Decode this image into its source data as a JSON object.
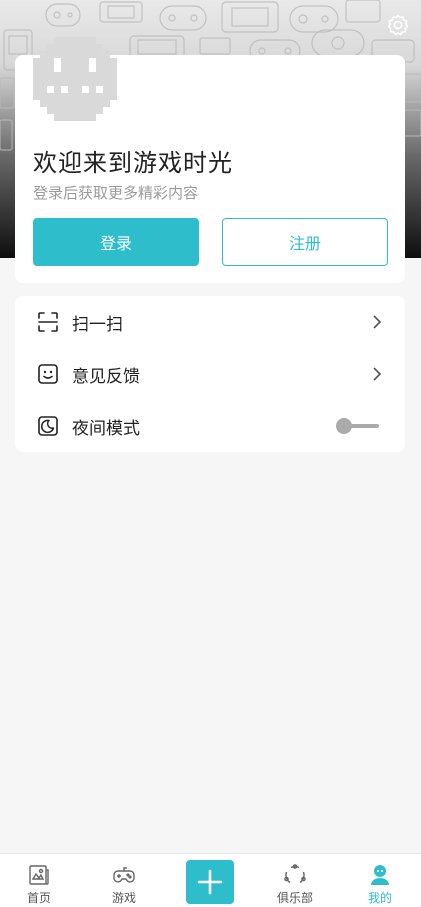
{
  "colors": {
    "accent": "#2dbdcb",
    "text": "#222222",
    "muted": "#9a9a9a",
    "background": "#f6f6f6"
  },
  "header": {
    "settings_icon": "gear-icon"
  },
  "profile": {
    "avatar_icon": "pixel-avatar-icon",
    "welcome": "欢迎来到游戏时光",
    "subtitle": "登录后获取更多精彩内容",
    "login_label": "登录",
    "register_label": "注册"
  },
  "menu": {
    "items": [
      {
        "label": "扫一扫",
        "icon": "scan-icon",
        "trailing": "chevron"
      },
      {
        "label": "意见反馈",
        "icon": "feedback-face-icon",
        "trailing": "chevron"
      },
      {
        "label": "夜间模式",
        "icon": "night-mode-icon",
        "trailing": "toggle",
        "enabled": false
      }
    ]
  },
  "tabbar": {
    "tabs": [
      {
        "label": "首页",
        "icon": "news-icon",
        "active": false
      },
      {
        "label": "游戏",
        "icon": "gamepad-icon",
        "active": false
      },
      {
        "label": "",
        "icon": "plus-icon",
        "active": false
      },
      {
        "label": "俱乐部",
        "icon": "club-icon",
        "active": false
      },
      {
        "label": "我的",
        "icon": "user-icon",
        "active": true
      }
    ]
  }
}
